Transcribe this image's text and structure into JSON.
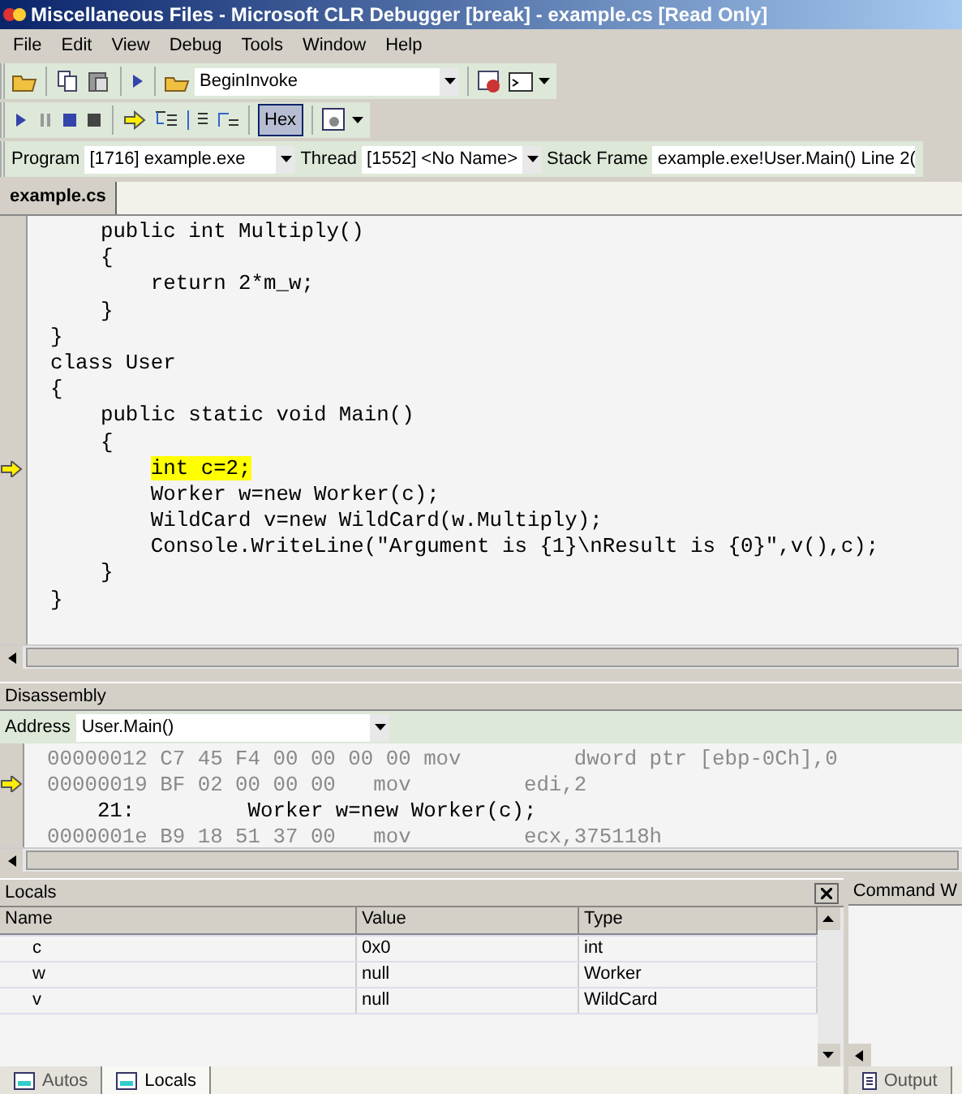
{
  "window": {
    "title": "Miscellaneous Files - Microsoft CLR Debugger [break] - example.cs [Read Only]"
  },
  "menu": [
    "File",
    "Edit",
    "View",
    "Debug",
    "Tools",
    "Window",
    "Help"
  ],
  "toolbar": {
    "combo": "BeginInvoke"
  },
  "debug_toolbar": {
    "hex": {
      "label": "Hex",
      "selected": true
    }
  },
  "location_bar": {
    "program_label": "Program",
    "program": "[1716] example.exe",
    "thread_label": "Thread",
    "thread": "[1552] <No Name>",
    "frame_label": "Stack Frame",
    "frame": "example.exe!User.Main() Line 2("
  },
  "tabs": [
    {
      "label": "example.cs",
      "selected": true
    }
  ],
  "editor": {
    "lines": [
      {
        "text": "    public int Multiply()",
        "current": false
      },
      {
        "text": "    {",
        "current": false
      },
      {
        "text": "        return 2*m_w;",
        "current": false
      },
      {
        "text": "    }",
        "current": false
      },
      {
        "text": "}",
        "current": false
      },
      {
        "text": "class User",
        "current": false
      },
      {
        "text": "{",
        "current": false
      },
      {
        "text": "    public static void Main()",
        "current": false
      },
      {
        "text": "    {",
        "current": false
      },
      {
        "text": "        int c=2;",
        "current": true
      },
      {
        "text": "        Worker w=new Worker(c);",
        "current": false
      },
      {
        "text": "        WildCard v=new WildCard(w.Multiply);",
        "current": false
      },
      {
        "text": "        Console.WriteLine(\"Argument is {1}\\nResult is {0}\",v(),c);",
        "current": false
      },
      {
        "text": "    }",
        "current": false
      },
      {
        "text": "}",
        "current": false
      }
    ]
  },
  "disassembly": {
    "title": "Disassembly",
    "address_label": "Address",
    "address": "User.Main()",
    "lines": [
      {
        "kind": "asm",
        "text": "00000012 C7 45 F4 00 00 00 00 mov         dword ptr [ebp-0Ch],0",
        "current": false
      },
      {
        "kind": "asm",
        "text": "00000019 BF 02 00 00 00   mov         edi,2",
        "current": true
      },
      {
        "kind": "source",
        "text": "    21:         Worker w=new Worker(c);",
        "current": false
      },
      {
        "kind": "asm",
        "text": "0000001e B9 18 51 37 00   mov         ecx,375118h",
        "current": false
      }
    ]
  },
  "locals": {
    "title": "Locals",
    "columns": [
      "Name",
      "Value",
      "Type"
    ],
    "rows": [
      [
        "c",
        "0x0",
        "int"
      ],
      [
        "w",
        "null",
        "Worker"
      ],
      [
        "v",
        "null",
        "WildCard"
      ]
    ]
  },
  "command_window": {
    "title": "Command W"
  },
  "bottom_tabs": [
    {
      "label": "Autos",
      "selected": false
    },
    {
      "label": "Locals",
      "selected": true
    }
  ],
  "right_tabs": [
    {
      "label": "Output",
      "selected": false
    }
  ]
}
